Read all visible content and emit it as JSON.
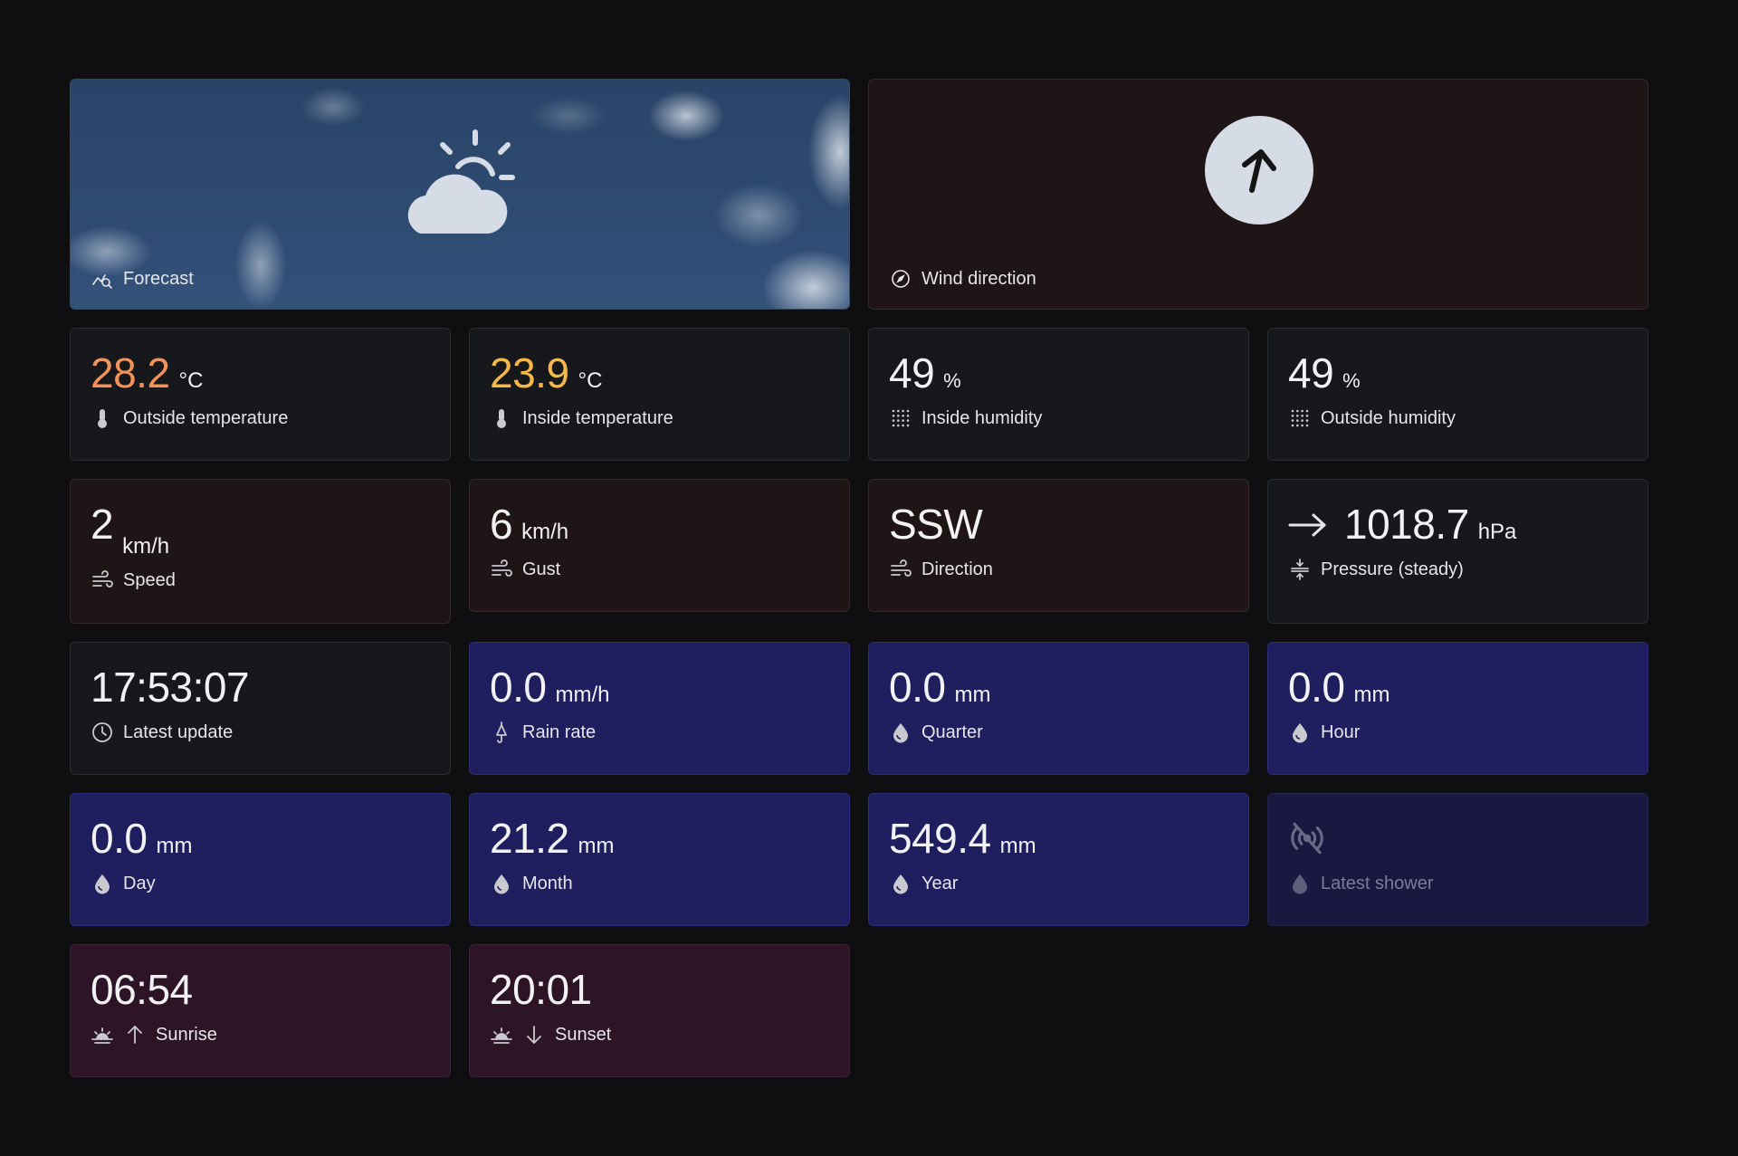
{
  "forecast": {
    "label": "Forecast",
    "icon": "partly-cloudy-day-icon"
  },
  "wind_direction": {
    "label": "Wind direction",
    "icon": "compass-icon",
    "arrow_icon": "arrow-up-right-icon"
  },
  "outside_temperature": {
    "value": "28.2",
    "unit": "°C",
    "label": "Outside temperature",
    "color": "#f3925a"
  },
  "inside_temperature": {
    "value": "23.9",
    "unit": "°C",
    "label": "Inside temperature",
    "color": "#f5b84a"
  },
  "inside_humidity": {
    "value": "49",
    "unit": "%",
    "label": "Inside humidity"
  },
  "outside_humidity": {
    "value": "49",
    "unit": "%",
    "label": "Outside humidity"
  },
  "speed": {
    "value": "2",
    "unit": "km/h",
    "label": "Speed"
  },
  "gust": {
    "value": "6",
    "unit": "km/h",
    "label": "Gust"
  },
  "direction": {
    "value": "SSW",
    "label": "Direction"
  },
  "pressure": {
    "value": "1018.7",
    "unit": "hPa",
    "label": "Pressure (steady)",
    "trend_icon": "arrow-right-icon"
  },
  "latest_update": {
    "value": "17:53:07",
    "label": "Latest update"
  },
  "rain_rate": {
    "value": "0.0",
    "unit": "mm/h",
    "label": "Rain rate"
  },
  "rain_quarter": {
    "value": "0.0",
    "unit": "mm",
    "label": "Quarter"
  },
  "rain_hour": {
    "value": "0.0",
    "unit": "mm",
    "label": "Hour"
  },
  "rain_day": {
    "value": "0.0",
    "unit": "mm",
    "label": "Day"
  },
  "rain_month": {
    "value": "21.2",
    "unit": "mm",
    "label": "Month"
  },
  "rain_year": {
    "value": "549.4",
    "unit": "mm",
    "label": "Year"
  },
  "latest_shower": {
    "label": "Latest shower",
    "icon": "no-signal-icon"
  },
  "sunrise": {
    "value": "06:54",
    "label": "Sunrise"
  },
  "sunset": {
    "value": "20:01",
    "label": "Sunset"
  },
  "colors": {
    "background": "#0f0f11",
    "card": "#17181b",
    "wind_card": "#201516",
    "rain_card": "#1f1e5e",
    "sun_card": "#2d1427"
  }
}
